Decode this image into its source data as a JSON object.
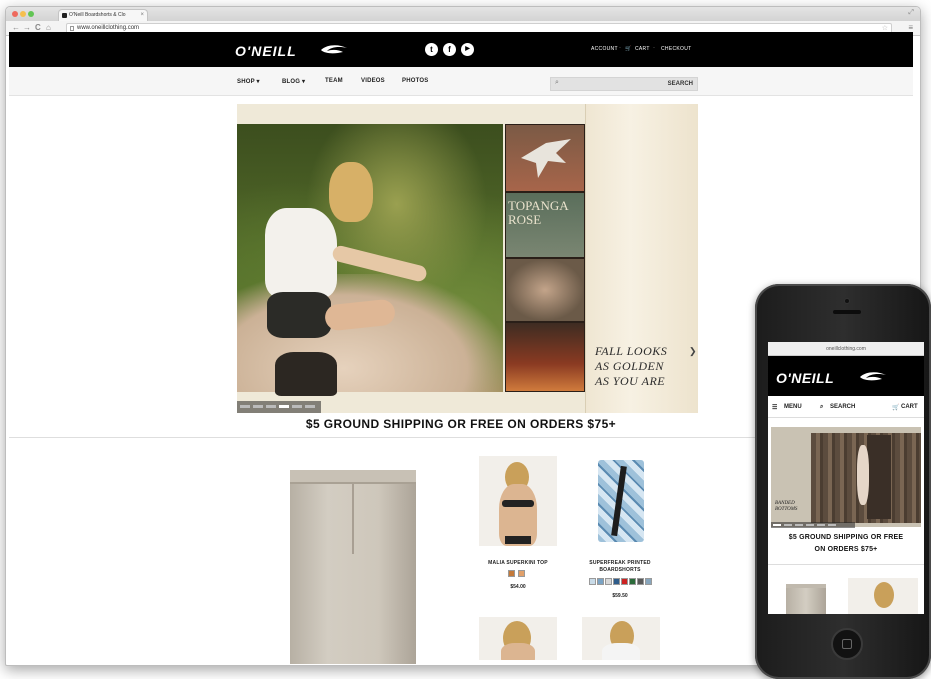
{
  "browser": {
    "tab_title": "O'Neill Boardshorts & Clo",
    "tab_close": "×",
    "url": "www.oneillclothing.com",
    "nav_back": "←",
    "nav_forward": "→",
    "reload": "C",
    "home": "⌂",
    "star": "☆",
    "menu": "≡",
    "resize": "⤢"
  },
  "site": {
    "logo": "O'NEILL",
    "social": [
      "t",
      "f",
      "▶"
    ],
    "account": [
      "ACCOUNT",
      "CART",
      "CHECKOUT"
    ],
    "nav": [
      "SHOP ▾",
      "BLOG ▾",
      "TEAM",
      "VIDEOS",
      "PHOTOS"
    ],
    "search_label": "SEARCH",
    "hero_tagline": "FALL LOOKS\nAS GOLDEN\nAS YOU ARE",
    "hero_sign": "TOPANGA\nROSE",
    "shipping": "$5 GROUND SHIPPING OR FREE ON ORDERS $75+",
    "products": [
      {
        "name": "MALIA SUPERKINI TOP",
        "price": "$54.00"
      },
      {
        "name": "SUPERFREAK PRINTED\nBOARDSHORTS",
        "price": "$59.50"
      }
    ]
  },
  "mobile": {
    "url": "oneillclothing.com",
    "logo": "O'NEILL",
    "menu": "MENU",
    "search": "SEARCH",
    "cart": "CART",
    "hero_text": "BANDED\nBOTTOMS",
    "shipping": "$5 GROUND SHIPPING OR FREE\nON ORDERS $75+"
  },
  "colors": {
    "header_bg": "#000000",
    "accent": "#ffffff"
  }
}
